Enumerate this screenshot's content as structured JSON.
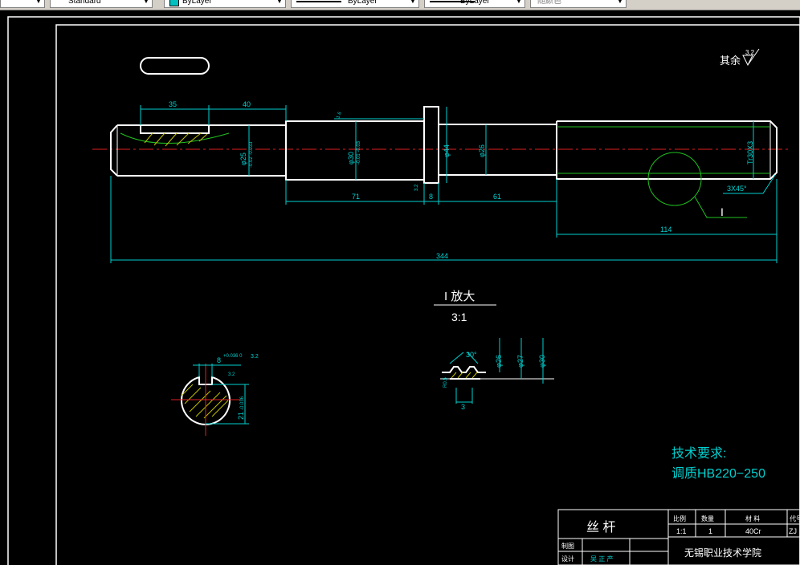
{
  "toolbar": {
    "text_style": "Standard",
    "layer": "ByLayer",
    "linetype": "ByLayer",
    "lineweight": "ByLayer",
    "color": "随颜色",
    "swatch_color": "#00c0c0"
  },
  "drawing": {
    "roughness_note": "其余",
    "roughness_value": "3.2",
    "dims": {
      "d35": "35",
      "d40": "40",
      "d71": "71",
      "d8": "8",
      "d61": "61",
      "d114": "114",
      "d344": "344",
      "chamfer": "3X45°",
      "phi25": "φ25",
      "phi25_tol": "-0.02 -0.033",
      "phi30": "φ30",
      "phi30_tol": "-0.01 -0.03",
      "phi44": "φ44",
      "phi26": "φ26",
      "tr": "Tr30X3",
      "rough_16": "1.6",
      "rough_32b": "3.2",
      "detail_ref": "I"
    },
    "detail": {
      "title": "I  放大",
      "scale": "3:1",
      "angle": "30°",
      "d26": "φ26",
      "d27": "φ27",
      "d30": "φ30",
      "pitch": "3",
      "r_note": "R0.5"
    },
    "section": {
      "width_dim": "8",
      "width_tol": "+0.036 0",
      "depth_dim": "21",
      "depth_tol": "-0.036",
      "rough": "3.2",
      "rough2": "3.2"
    },
    "tech_req": {
      "title": "技术要求:",
      "line1": "调质HB220−250"
    },
    "title_block": {
      "part_name": "丝  杆",
      "scale_label": "比例",
      "qty_label": "数量",
      "material_label": "材  料",
      "code_label": "代号",
      "scale": "1:1",
      "qty": "1",
      "material": "40Cr",
      "code": "ZJ",
      "drawn": "制图",
      "designer_label": "设计",
      "designer": "吴 正 产",
      "school": "无锡职业技术学院"
    }
  }
}
